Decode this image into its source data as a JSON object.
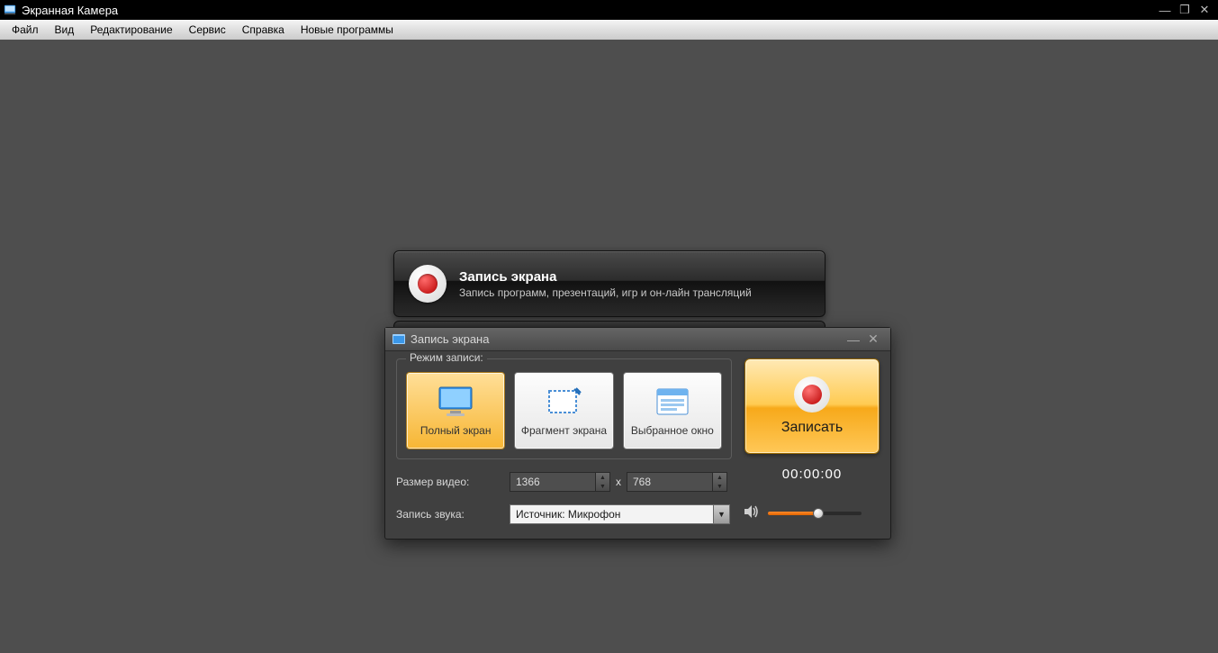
{
  "window": {
    "title": "Экранная Камера"
  },
  "menu": {
    "file": "Файл",
    "view": "Вид",
    "edit": "Редактирование",
    "service": "Сервис",
    "help": "Справка",
    "new_programs": "Новые программы"
  },
  "banner": {
    "title": "Запись экрана",
    "subtitle": "Запись программ, презентаций, игр и он-лайн трансляций"
  },
  "dialog": {
    "title": "Запись экрана",
    "mode_group_label": "Режим записи:",
    "modes": {
      "full": "Полный экран",
      "fragment": "Фрагмент экрана",
      "window": "Выбранное окно"
    },
    "record_label": "Записать",
    "timecode": "00:00:00",
    "size_label": "Размер видео:",
    "width": "1366",
    "height": "768",
    "x_sep": "x",
    "audio_label": "Запись звука:",
    "audio_source": "Источник: Микрофон",
    "volume_percent": 54
  }
}
